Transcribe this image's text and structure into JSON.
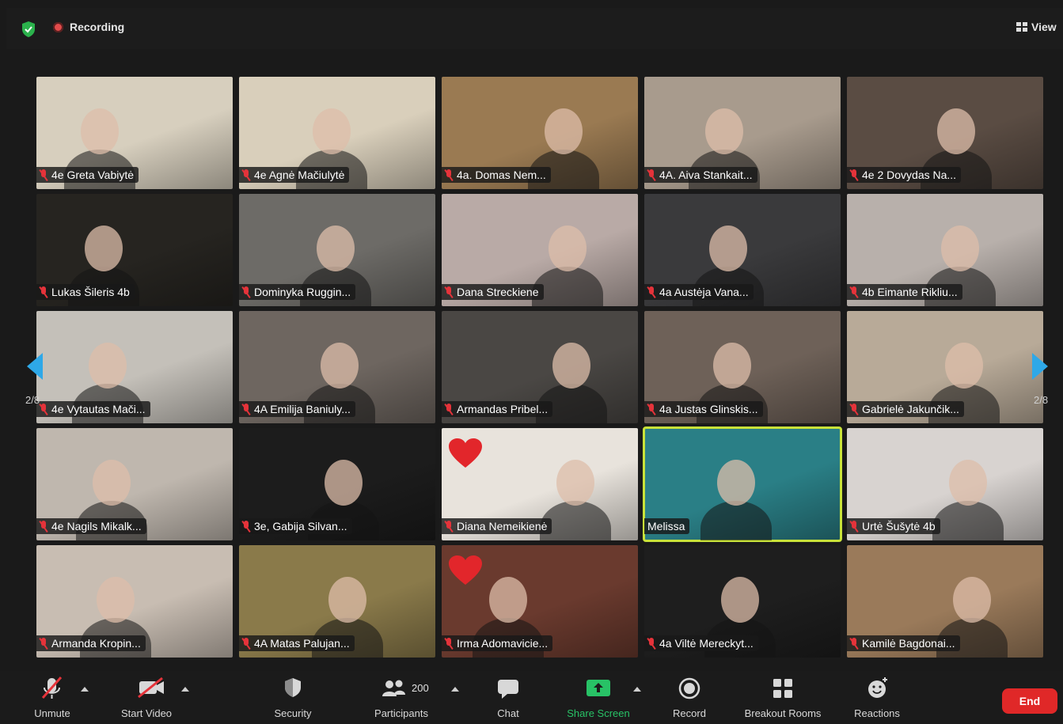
{
  "topbar": {
    "recording_label": "Recording",
    "view_label": "View"
  },
  "pagination": {
    "left": "2/8",
    "right": "2/8"
  },
  "participants": [
    {
      "name": "4e Greta Vabiytė",
      "bg": "#d7cfbe",
      "muted": true
    },
    {
      "name": "4e Agnė Mačiulytė",
      "bg": "#d9cfbb",
      "muted": true
    },
    {
      "name": "4a. Domas Nem...",
      "bg": "#9a7a52",
      "muted": true
    },
    {
      "name": "4A. Aiva Stankait...",
      "bg": "#a89b8d",
      "muted": true
    },
    {
      "name": "4e 2 Dovydas Na...",
      "bg": "#5a4c43",
      "muted": true
    },
    {
      "name": "Lukas Šileris 4b",
      "bg": "#262420",
      "muted": true
    },
    {
      "name": "Dominyka Ruggin...",
      "bg": "#6d6b67",
      "muted": true
    },
    {
      "name": "Dana Streckiene",
      "bg": "#b9aaa6",
      "muted": true
    },
    {
      "name": "4a Austėja Vana...",
      "bg": "#3a3a3c",
      "muted": true
    },
    {
      "name": "4b Eimante Rikliu...",
      "bg": "#b8b0ab",
      "muted": true
    },
    {
      "name": "4e Vytautas Mači...",
      "bg": "#c4c0b9",
      "muted": true
    },
    {
      "name": "4A Emilija Baniuly...",
      "bg": "#6e6660",
      "muted": true
    },
    {
      "name": "Armandas Pribel...",
      "bg": "#4a4744",
      "muted": true
    },
    {
      "name": "4a Justas Glinskis...",
      "bg": "#6e6158",
      "muted": true
    },
    {
      "name": "Gabrielė Jakunčik...",
      "bg": "#b8aa98",
      "muted": true
    },
    {
      "name": "4e Nagils Mikalk...",
      "bg": "#bfb7ae",
      "muted": true
    },
    {
      "name": "3e, Gabija Silvan...",
      "bg": "#1c1c1c",
      "muted": true
    },
    {
      "name": "Diana Nemeikienė",
      "bg": "#e8e3dc",
      "muted": true,
      "heart": true
    },
    {
      "name": "Melissa",
      "bg": "#2a7f86",
      "muted": false,
      "active": true
    },
    {
      "name": "Urtė Šušytė 4b",
      "bg": "#d8d3d0",
      "muted": true
    },
    {
      "name": "Armanda Kropin...",
      "bg": "#c8bdb2",
      "muted": true
    },
    {
      "name": "4A Matas Palujan...",
      "bg": "#8a7a4a",
      "muted": true
    },
    {
      "name": "Irma Adomavicie...",
      "bg": "#6a3a2e",
      "muted": true,
      "heart": true
    },
    {
      "name": "4a Viltė Mereckyt...",
      "bg": "#1e1e1e",
      "muted": true
    },
    {
      "name": "Kamilė Bagdonai...",
      "bg": "#9a7a5a",
      "muted": true
    }
  ],
  "toolbar": {
    "unmute": "Unmute",
    "start_video": "Start Video",
    "security": "Security",
    "participants": "Participants",
    "participants_count": "200",
    "chat": "Chat",
    "share_screen": "Share Screen",
    "record": "Record",
    "breakout_rooms": "Breakout Rooms",
    "reactions": "Reactions",
    "end": "End"
  },
  "colors": {
    "accent_green": "#28c266",
    "end_red": "#e02828",
    "active_outline": "#c8e23a",
    "arrow_blue": "#2ea8e8"
  }
}
